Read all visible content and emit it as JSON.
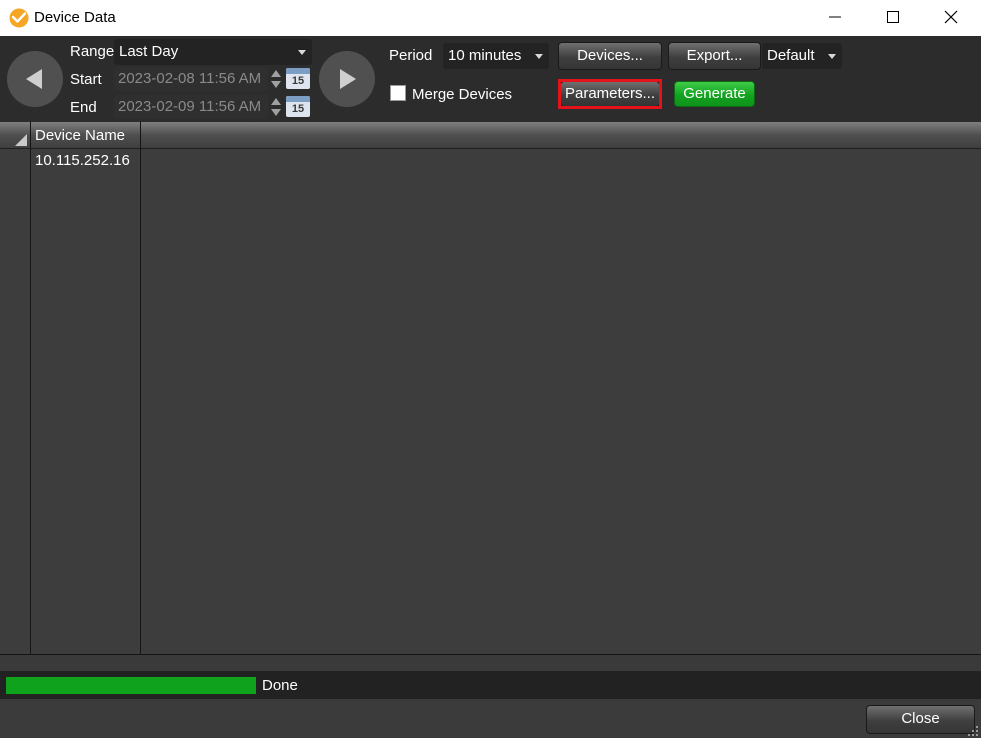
{
  "window": {
    "title": "Device Data"
  },
  "toolbar": {
    "range_label": "Range",
    "range_value": "Last Day",
    "start_label": "Start",
    "start_value": "2023-02-08 11:56 AM",
    "end_label": "End",
    "end_value": "2023-02-09 11:56 AM",
    "calendar_day": "15",
    "period_label": "Period",
    "period_value": "10 minutes",
    "devices_label": "Devices...",
    "export_label": "Export...",
    "export_format_value": "Default",
    "merge_label": "Merge Devices",
    "merge_checked": false,
    "parameters_label": "Parameters...",
    "generate_label": "Generate"
  },
  "grid": {
    "columns": [
      "Device Name"
    ],
    "rows": [
      {
        "device_name": "10.115.252.16"
      }
    ]
  },
  "status": {
    "progress": 1.0,
    "text": "Done"
  },
  "footer": {
    "close_label": "Close"
  },
  "colors": {
    "accent_green": "#0fa21c",
    "highlight_red": "#e4131b",
    "app_icon": "#f5a623"
  },
  "icons": {
    "app": "app-logo-icon",
    "prev": "arrow-left-icon",
    "next": "arrow-right-icon",
    "calendar": "calendar-icon",
    "spinner": "spinner-updown-icon"
  }
}
